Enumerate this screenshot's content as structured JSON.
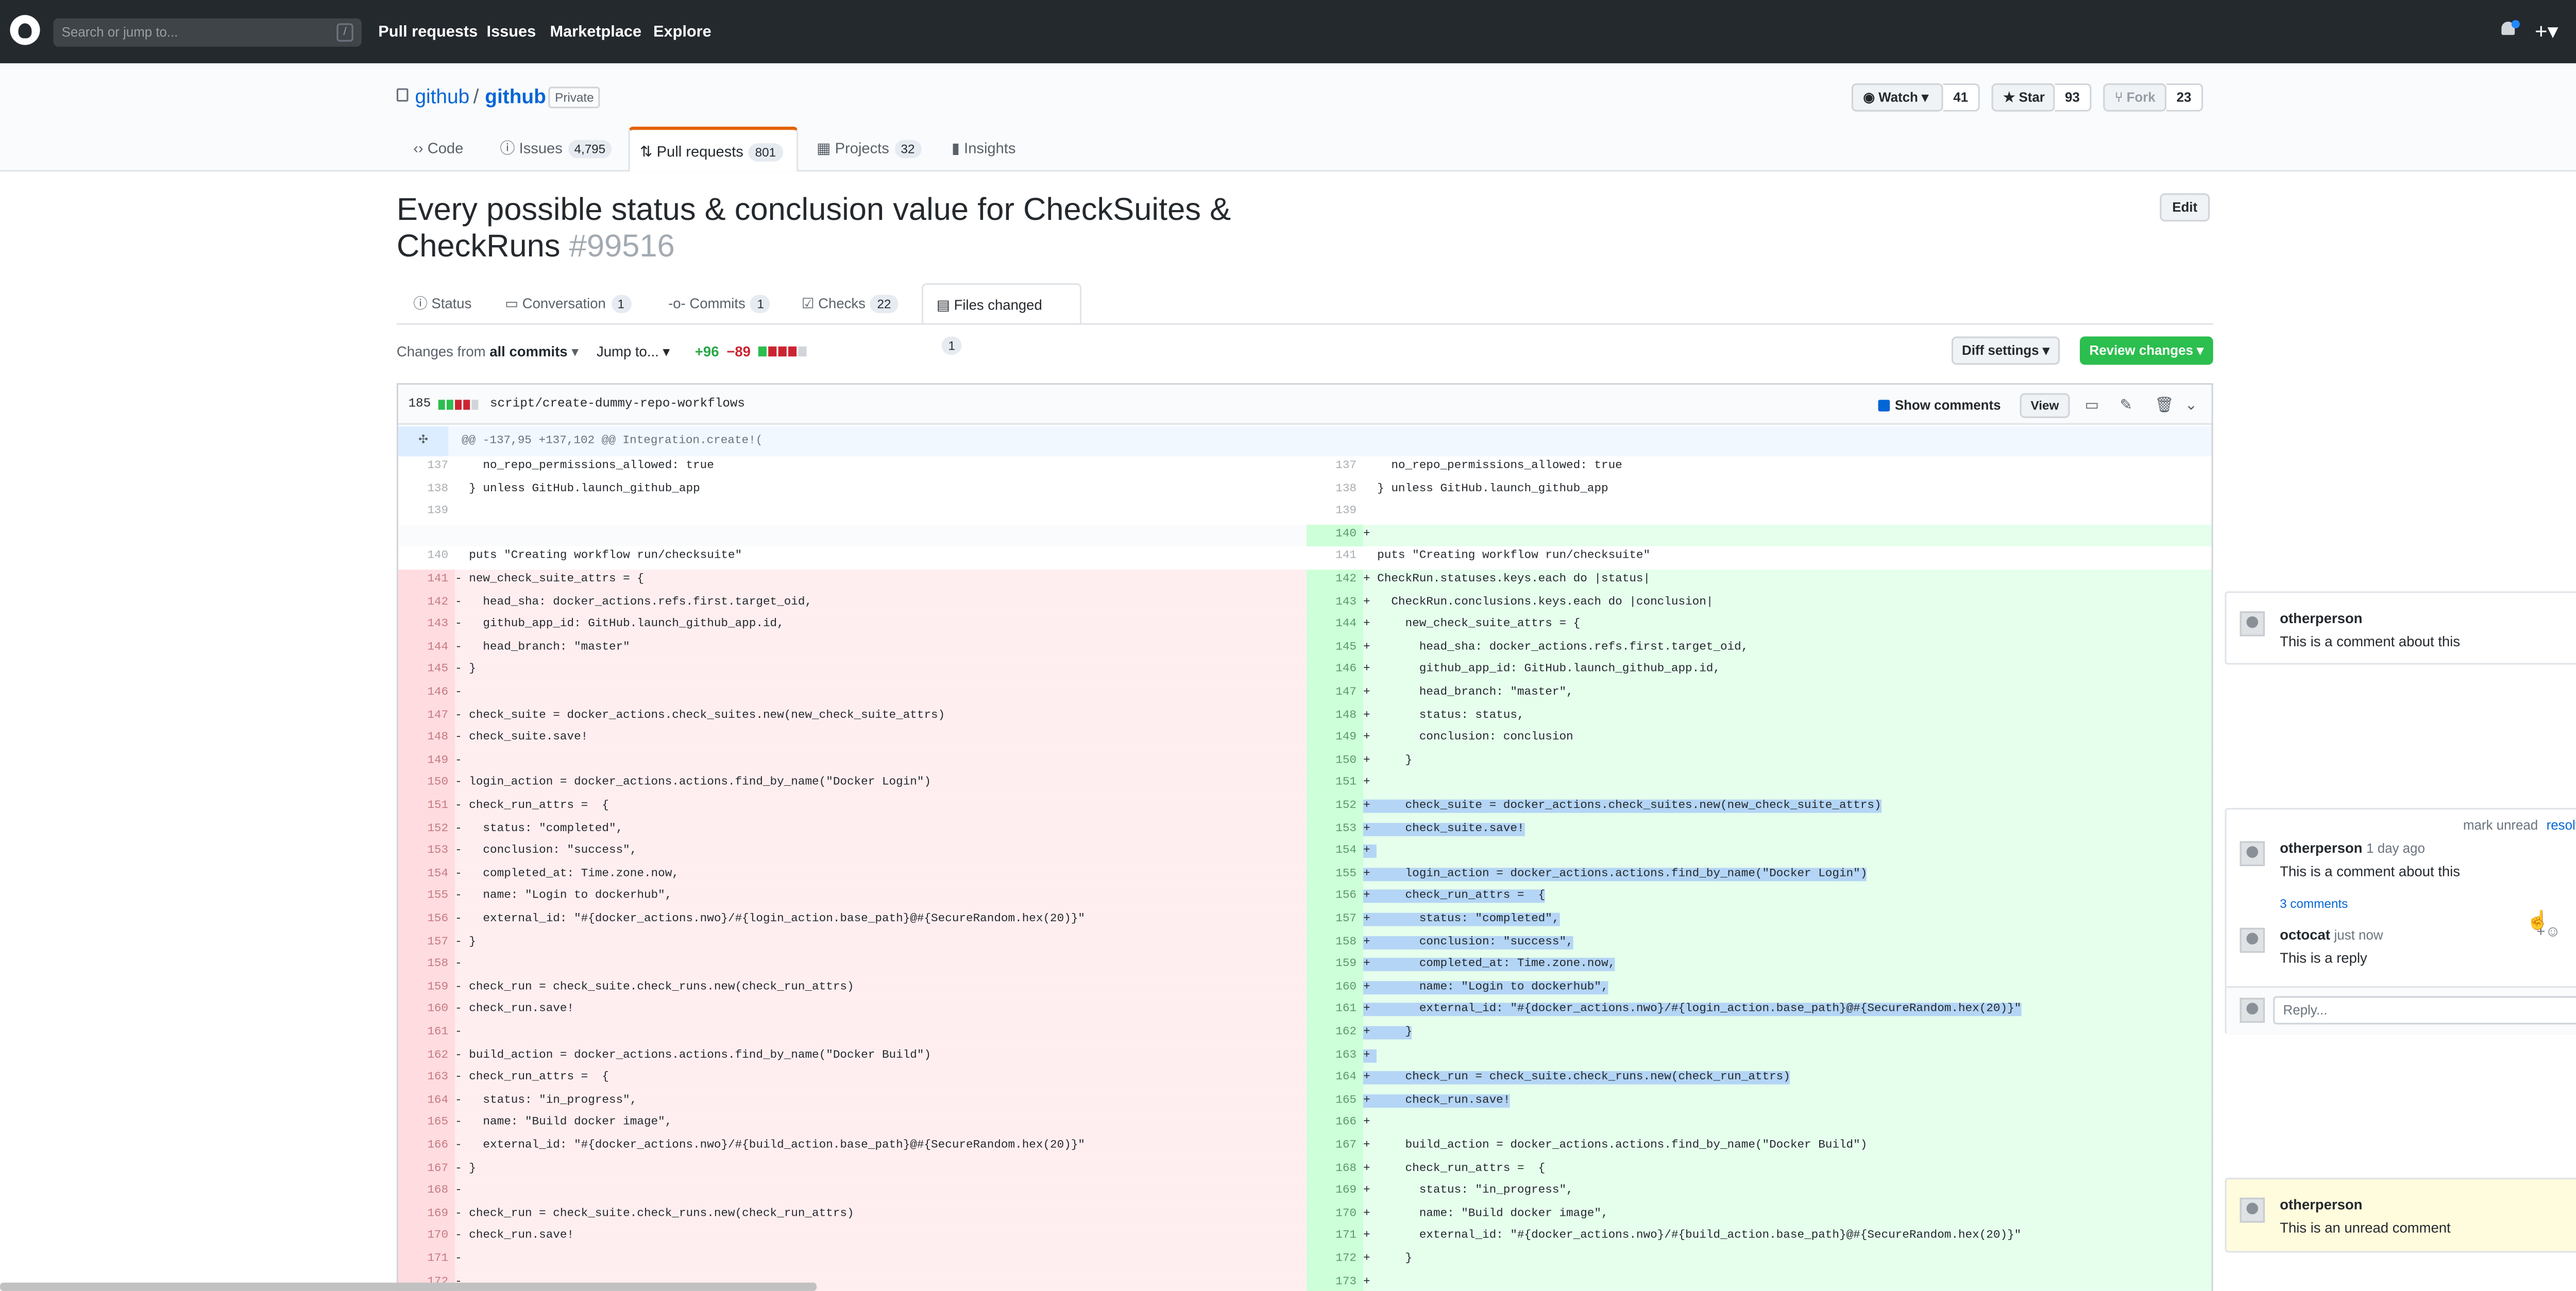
{
  "header": {
    "search_placeholder": "Search or jump to...",
    "search_shortcut": "/",
    "nav": [
      "Pull requests",
      "Issues",
      "Marketplace",
      "Explore"
    ]
  },
  "repo": {
    "owner": "github",
    "separator": "/",
    "name": "github",
    "visibility": "Private",
    "watch_label": "Watch",
    "watch_count": "41",
    "star_label": "Star",
    "star_count": "93",
    "fork_label": "Fork",
    "fork_count": "23",
    "tabs": [
      {
        "label": "Code",
        "count": ""
      },
      {
        "label": "Issues",
        "count": "4,795"
      },
      {
        "label": "Pull requests",
        "count": "801"
      },
      {
        "label": "Projects",
        "count": "32"
      },
      {
        "label": "Insights",
        "count": ""
      }
    ]
  },
  "pr": {
    "title": "Every possible status & conclusion value for CheckSuites & CheckRuns",
    "number": "#99516",
    "edit_label": "Edit",
    "tabs": [
      {
        "label": "Status",
        "count": ""
      },
      {
        "label": "Conversation",
        "count": "1"
      },
      {
        "label": "Commits",
        "count": "1"
      },
      {
        "label": "Checks",
        "count": "22"
      },
      {
        "label": "Files changed",
        "count": "1"
      }
    ]
  },
  "toolbar": {
    "changes_from": "Changes from",
    "all_commits": "all commits",
    "jump_to": "Jump to...",
    "additions": "+96",
    "deletions": "−89",
    "diff_settings": "Diff settings",
    "review_changes": "Review changes"
  },
  "file": {
    "change_count": "185",
    "path": "script/create-dummy-repo-workflows",
    "show_comments_label": "Show comments",
    "show_comments_checked": true,
    "view_label": "View",
    "icons": [
      "desktop-icon",
      "pencil-icon",
      "trash-icon",
      "chevron-down-icon"
    ],
    "hunk_header": "@@ -137,95 +137,102 @@ Integration.create!("
  },
  "diff_left": [
    {
      "n": "137",
      "t": "ctx",
      "c": "    no_repo_permissions_allowed: true"
    },
    {
      "n": "138",
      "t": "ctx",
      "c": "  } unless GitHub.launch_github_app"
    },
    {
      "n": "139",
      "t": "ctx",
      "c": ""
    },
    {
      "n": "",
      "t": "empty",
      "c": ""
    },
    {
      "n": "140",
      "t": "ctx",
      "c": "  puts \"Creating workflow run/checksuite\""
    },
    {
      "n": "141",
      "t": "del",
      "c": "- new_check_suite_attrs = {"
    },
    {
      "n": "142",
      "t": "del",
      "c": "-   head_sha: docker_actions.refs.first.target_oid,"
    },
    {
      "n": "143",
      "t": "del",
      "c": "-   github_app_id: GitHub.launch_github_app.id,"
    },
    {
      "n": "144",
      "t": "del",
      "c": "-   head_branch: \"master\""
    },
    {
      "n": "145",
      "t": "del",
      "c": "- }"
    },
    {
      "n": "146",
      "t": "del",
      "c": "-"
    },
    {
      "n": "147",
      "t": "del",
      "c": "- check_suite = docker_actions.check_suites.new(new_check_suite_attrs)"
    },
    {
      "n": "148",
      "t": "del",
      "c": "- check_suite.save!"
    },
    {
      "n": "149",
      "t": "del",
      "c": "-"
    },
    {
      "n": "150",
      "t": "del",
      "c": "- login_action = docker_actions.actions.find_by_name(\"Docker Login\")"
    },
    {
      "n": "151",
      "t": "del",
      "c": "- check_run_attrs =  {"
    },
    {
      "n": "152",
      "t": "del",
      "c": "-   status: \"completed\","
    },
    {
      "n": "153",
      "t": "del",
      "c": "-   conclusion: \"success\","
    },
    {
      "n": "154",
      "t": "del",
      "c": "-   completed_at: Time.zone.now,"
    },
    {
      "n": "155",
      "t": "del",
      "c": "-   name: \"Login to dockerhub\","
    },
    {
      "n": "156",
      "t": "del",
      "c": "-   external_id: \"#{docker_actions.nwo}/#{login_action.base_path}@#{SecureRandom.hex(20)}\""
    },
    {
      "n": "157",
      "t": "del",
      "c": "- }"
    },
    {
      "n": "158",
      "t": "del",
      "c": "-"
    },
    {
      "n": "159",
      "t": "del",
      "c": "- check_run = check_suite.check_runs.new(check_run_attrs)"
    },
    {
      "n": "160",
      "t": "del",
      "c": "- check_run.save!"
    },
    {
      "n": "161",
      "t": "del",
      "c": "-"
    },
    {
      "n": "162",
      "t": "del",
      "c": "- build_action = docker_actions.actions.find_by_name(\"Docker Build\")"
    },
    {
      "n": "163",
      "t": "del",
      "c": "- check_run_attrs =  {"
    },
    {
      "n": "164",
      "t": "del",
      "c": "-   status: \"in_progress\","
    },
    {
      "n": "165",
      "t": "del",
      "c": "-   name: \"Build docker image\","
    },
    {
      "n": "166",
      "t": "del",
      "c": "-   external_id: \"#{docker_actions.nwo}/#{build_action.base_path}@#{SecureRandom.hex(20)}\""
    },
    {
      "n": "167",
      "t": "del",
      "c": "- }"
    },
    {
      "n": "168",
      "t": "del",
      "c": "-"
    },
    {
      "n": "169",
      "t": "del",
      "c": "- check_run = check_suite.check_runs.new(check_run_attrs)"
    },
    {
      "n": "170",
      "t": "del",
      "c": "- check_run.save!"
    },
    {
      "n": "171",
      "t": "del",
      "c": "-"
    },
    {
      "n": "172",
      "t": "del",
      "c": "-"
    }
  ],
  "diff_right": [
    {
      "n": "137",
      "t": "ctx",
      "c": "    no_repo_permissions_allowed: true",
      "s": false
    },
    {
      "n": "138",
      "t": "ctx",
      "c": "  } unless GitHub.launch_github_app",
      "s": false
    },
    {
      "n": "139",
      "t": "ctx",
      "c": "",
      "s": false
    },
    {
      "n": "140",
      "t": "add",
      "c": "+",
      "s": false
    },
    {
      "n": "141",
      "t": "ctx",
      "c": "  puts \"Creating workflow run/checksuite\"",
      "s": false
    },
    {
      "n": "142",
      "t": "add",
      "c": "+ CheckRun.statuses.keys.each do |status|",
      "s": false
    },
    {
      "n": "143",
      "t": "add",
      "c": "+   CheckRun.conclusions.keys.each do |conclusion|",
      "s": false
    },
    {
      "n": "144",
      "t": "add",
      "c": "+     new_check_suite_attrs = {",
      "s": false
    },
    {
      "n": "145",
      "t": "add",
      "c": "+       head_sha: docker_actions.refs.first.target_oid,",
      "s": false
    },
    {
      "n": "146",
      "t": "add",
      "c": "+       github_app_id: GitHub.launch_github_app.id,",
      "s": false
    },
    {
      "n": "147",
      "t": "add",
      "c": "+       head_branch: \"master\",",
      "s": false
    },
    {
      "n": "148",
      "t": "add",
      "c": "+       status: status,",
      "s": false
    },
    {
      "n": "149",
      "t": "add",
      "c": "+       conclusion: conclusion",
      "s": false
    },
    {
      "n": "150",
      "t": "add",
      "c": "+     }",
      "s": false
    },
    {
      "n": "151",
      "t": "add",
      "c": "+",
      "s": false
    },
    {
      "n": "152",
      "t": "add",
      "c": "+     check_suite = docker_actions.check_suites.new(new_check_suite_attrs)",
      "s": true
    },
    {
      "n": "153",
      "t": "add",
      "c": "+     check_suite.save!",
      "s": true
    },
    {
      "n": "154",
      "t": "add",
      "c": "+ ",
      "s": true
    },
    {
      "n": "155",
      "t": "add",
      "c": "+     login_action = docker_actions.actions.find_by_name(\"Docker Login\")",
      "s": true
    },
    {
      "n": "156",
      "t": "add",
      "c": "+     check_run_attrs =  {",
      "s": true
    },
    {
      "n": "157",
      "t": "add",
      "c": "+       status: \"completed\",",
      "s": true
    },
    {
      "n": "158",
      "t": "add",
      "c": "+       conclusion: \"success\",",
      "s": true
    },
    {
      "n": "159",
      "t": "add",
      "c": "+       completed_at: Time.zone.now,",
      "s": true
    },
    {
      "n": "160",
      "t": "add",
      "c": "+       name: \"Login to dockerhub\",",
      "s": true
    },
    {
      "n": "161",
      "t": "add",
      "c": "+       external_id: \"#{docker_actions.nwo}/#{login_action.base_path}@#{SecureRandom.hex(20)}\"",
      "s": true
    },
    {
      "n": "162",
      "t": "add",
      "c": "+     }",
      "s": true
    },
    {
      "n": "163",
      "t": "add",
      "c": "+ ",
      "s": true
    },
    {
      "n": "164",
      "t": "add",
      "c": "+     check_run = check_suite.check_runs.new(check_run_attrs)",
      "s": true
    },
    {
      "n": "165",
      "t": "add",
      "c": "+     check_run.save!",
      "s": true
    },
    {
      "n": "166",
      "t": "add",
      "c": "+",
      "s": false
    },
    {
      "n": "167",
      "t": "add",
      "c": "+     build_action = docker_actions.actions.find_by_name(\"Docker Build\")",
      "s": false
    },
    {
      "n": "168",
      "t": "add",
      "c": "+     check_run_attrs =  {",
      "s": false
    },
    {
      "n": "169",
      "t": "add",
      "c": "+       status: \"in_progress\",",
      "s": false
    },
    {
      "n": "170",
      "t": "add",
      "c": "+       name: \"Build docker image\",",
      "s": false
    },
    {
      "n": "171",
      "t": "add",
      "c": "+       external_id: \"#{docker_actions.nwo}/#{build_action.base_path}@#{SecureRandom.hex(20)}\"",
      "s": false
    },
    {
      "n": "172",
      "t": "add",
      "c": "+     }",
      "s": false
    },
    {
      "n": "173",
      "t": "add",
      "c": "+",
      "s": false
    }
  ],
  "comments": {
    "c1": {
      "author": "otherperson",
      "body": "This is a comment about this"
    },
    "thread": {
      "mark_unread": "mark unread",
      "resolve": "resolve",
      "author": "otherperson",
      "time": "1 day ago",
      "body": "This is a comment about this",
      "more": "3 comments",
      "reply_author": "octocat",
      "reply_time": "just now",
      "reply_body": "This is a reply",
      "reply_placeholder": "Reply..."
    },
    "c3": {
      "author": "otherperson",
      "body": "This is an unread comment",
      "bg": "#fffbdd"
    }
  },
  "colors": {
    "header_bg": "#24292e",
    "link": "#0366d6",
    "add_bg": "#e6ffed",
    "del_bg": "#ffeef0",
    "selection": "#b4d5f5",
    "primary_btn": "#2cbe4e"
  }
}
